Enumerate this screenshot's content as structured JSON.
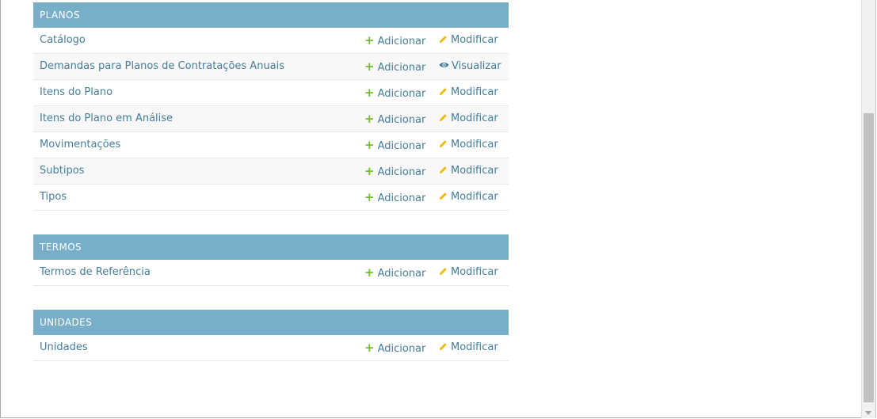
{
  "modules": [
    {
      "caption": "PLANOS",
      "rows": [
        {
          "model": "Catálogo",
          "add": "Adicionar",
          "action": "Modificar",
          "action_icon": "pencil-icon"
        },
        {
          "model": "Demandas para Planos de Contratações Anuais",
          "add": "Adicionar",
          "action": "Visualizar",
          "action_icon": "eye-icon"
        },
        {
          "model": "Itens do Plano",
          "add": "Adicionar",
          "action": "Modificar",
          "action_icon": "pencil-icon"
        },
        {
          "model": "Itens do Plano em Análise",
          "add": "Adicionar",
          "action": "Modificar",
          "action_icon": "pencil-icon"
        },
        {
          "model": "Movimentações",
          "add": "Adicionar",
          "action": "Modificar",
          "action_icon": "pencil-icon"
        },
        {
          "model": "Subtipos",
          "add": "Adicionar",
          "action": "Modificar",
          "action_icon": "pencil-icon"
        },
        {
          "model": "Tipos",
          "add": "Adicionar",
          "action": "Modificar",
          "action_icon": "pencil-icon"
        }
      ]
    },
    {
      "caption": "TERMOS",
      "rows": [
        {
          "model": "Termos de Referência",
          "add": "Adicionar",
          "action": "Modificar",
          "action_icon": "pencil-icon"
        }
      ]
    },
    {
      "caption": "UNIDADES",
      "rows": [
        {
          "model": "Unidades",
          "add": "Adicionar",
          "action": "Modificar",
          "action_icon": "pencil-icon"
        }
      ]
    }
  ],
  "colors": {
    "caption_bg": "#79aec8",
    "link": "#447e9b",
    "add_icon": "#70bf2b",
    "edit_icon": "#efb80b"
  }
}
